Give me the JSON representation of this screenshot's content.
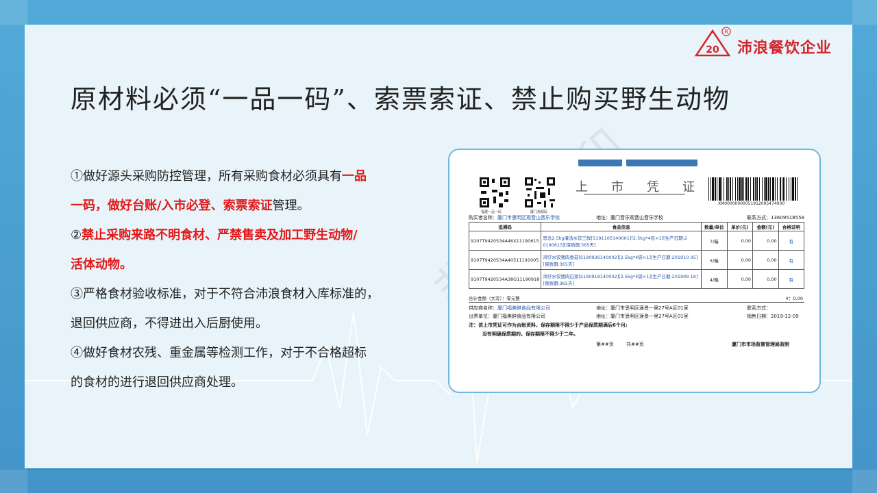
{
  "logo": {
    "text": "沛浪餐饮企业",
    "mark": "20",
    "registered": "R"
  },
  "watermark": "非会员水印",
  "title": "原材料必须“一品一码”、索票索证、禁止购买野生动物",
  "bullets": {
    "b1_a": "①做好源头采购防控管理，所有采购食材必须具有",
    "b1_red1": "一品",
    "b1_red2": "一码，做好台账/入市必登、索票索证",
    "b1_b": "管理。",
    "b2_num": "②",
    "b2_red1": "禁止采购来路不明食材、严禁售卖及加工野生动物/",
    "b2_red2": "活体动物。",
    "b3_1": "③严格食材验收标准，对于不符合沛浪食材入库标准的，",
    "b3_2": "退回供应商，不得进出入后厨使用。",
    "b4_1": "④做好食材农残、重金属等检测工作，对于不合格超标",
    "b4_2": "的食材的进行退回供应商处理。"
  },
  "certificate": {
    "title_chars": "上市凭证",
    "qr1_caption": "福建一品一码",
    "qr2_caption": "厦门溯源码",
    "barcode_number": "XM00000000051912095474000",
    "buyer_label": "购买者名称：",
    "buyer": "厦门市思明区观音山音乐学校",
    "buyer_address": "地址：厦门音乐观音山音乐学校",
    "contact": "联系方式：13609518558",
    "headers": [
      "追溯码",
      "食品信息",
      "数量/单位",
      "单价(元)",
      "金额(元)",
      "合格证明"
    ],
    "rows": [
      {
        "code": "9107T9420534A46X11190615",
        "info": "思念2.5kg灌汤水饺三鲜[S191105140001][2.5kg*4包×1][生产日期:2 0190615][保质期:365天]",
        "qty": "7/箱",
        "price": "0.00",
        "amount": "0.00",
        "cert": "有"
      },
      {
        "code": "9107T9420534A40511191005",
        "info": "湾仔水饺猪肉香菇[S190926140002][2.5kg*4袋×1][生产日期:201910 05][保质期:365天]",
        "qty": "5/箱",
        "price": "0.00",
        "amount": "0.00",
        "cert": "有"
      },
      {
        "code": "9107T9420534A38G11190918",
        "info": "湾仔水饺猪肉白菜[S190918140002][2.5kg*4袋×1][生产日期:201909 18][保质期:365天]",
        "qty": "4/箱",
        "price": "0.00",
        "amount": "0.00",
        "cert": "有"
      }
    ],
    "total_label": "合计金额（大写）：零元整",
    "total_value": "¥：0.00",
    "supplier_label": "供应商名称：",
    "supplier": "厦门福美鲜食品有限公司",
    "supplier_address": "地址：厦门市思明区莲景一里27号A区01室",
    "supplier_contact": "联系方式：",
    "issuer": "出票单位：厦门福美鲜食品有限公司",
    "issuer_address": "地址：厦门市思明区莲景一里27号A区01室",
    "sale_date": "销售日期：2019-12-09",
    "note1": "注：该上市凭证可作为台账资料，保存期限不得少于产品保质期满后6个月;",
    "note2": "没有明确保质期的，保存期限不得少于二年。",
    "page_current": "第##页",
    "page_total": "共##页",
    "supervisor": "厦门市市场监督管理局监制"
  }
}
